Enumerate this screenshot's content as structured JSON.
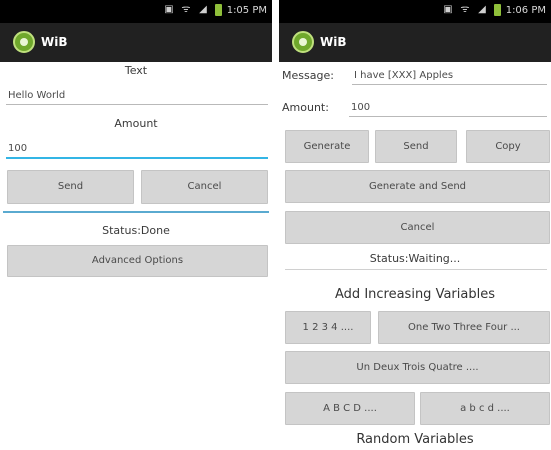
{
  "left_screen": {
    "status_time": "1:05 PM",
    "app_title": "WiB",
    "text_label": "Text",
    "text_value": "Hello World",
    "amount_label": "Amount",
    "amount_value": "100",
    "send_button": "Send",
    "cancel_button": "Cancel",
    "status_text": "Status:Done",
    "advanced_button": "Advanced Options"
  },
  "right_screen": {
    "status_time": "1:06 PM",
    "app_title": "WiB",
    "message_label": "Message:",
    "message_value": "I have [XXX] Apples",
    "amount_label": "Amount:",
    "amount_value": "100",
    "generate_button": "Generate",
    "send_button": "Send",
    "copy_button": "Copy",
    "generate_and_send_button": "Generate and Send",
    "cancel_button": "Cancel",
    "status_text": "Status:Waiting...",
    "increasing_title": "Add Increasing Variables",
    "numbers_button": "1 2 3 4 ....",
    "words_button": "One Two Three Four ...",
    "french_button": "Un Deux Trois Quatre ....",
    "upper_button": "A B C D ....",
    "lower_button": "a b c d ....",
    "random_title": "Random Variables"
  },
  "status_icons": [
    "sim-icon",
    "wifi-icon",
    "signal-icon",
    "battery-icon"
  ],
  "colors": {
    "status_bar": "#000000",
    "action_bar": "#212121",
    "accent_blue": "#33b5e5",
    "button_grey": "#d6d6d6",
    "logo_green": "#6fa82c"
  }
}
